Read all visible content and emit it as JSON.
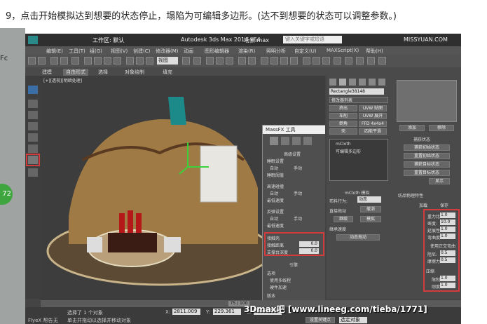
{
  "caption": "9，点击开始模拟达到想要的状态停止，塌陷为可编辑多边形。(达不到想要的状态可以调整参数。)",
  "left_text": "Fc",
  "left_badge": "72",
  "app": {
    "workspace": "工作区: 默认",
    "title": "Autodesk 3ds Max  2014 x64",
    "file": "场景.max",
    "search_placeholder": "键入关键字或短语",
    "site_logo": "MISSYUAN.COM",
    "menus": [
      "编辑(E)",
      "工具(T)",
      "组(G)",
      "视图(V)",
      "创建(C)",
      "修改器(M)",
      "动画",
      "图形编辑器",
      "渲染(R)",
      "照明分析",
      "自定义(U)",
      "MAXScript(X)",
      "帮助(H)"
    ],
    "ribbon_tabs": [
      "建模",
      "自由形式",
      "选择",
      "对象绘制",
      "填充"
    ],
    "view_dropdown": "视图",
    "viewport_label": "[+][透视][明暗处理]"
  },
  "massfx": {
    "title": "MassFX 工具",
    "sections": {
      "advanced": "高级设置",
      "sleep": "睡眠设置",
      "auto": "自动",
      "manual": "手动",
      "sleep_threshold": "睡眠阈值",
      "high_speed": "高速碰撞",
      "min_speed": "最低速度",
      "bounce": "反弹设置",
      "contact_shell": "接触壳",
      "contact_distance_label": "接触距离",
      "contact_distance": "0.0",
      "support_depth_label": "支撑台深度",
      "support_depth": "0.0",
      "engine": "引擎",
      "options": "选项",
      "use_multithread": "使用多线程",
      "hardware_accel": "硬件加速",
      "version": "版本"
    }
  },
  "modifier": {
    "object_name": "Rectangle38148",
    "modifier_list": "修改器列表",
    "buttons": [
      "挤出",
      "UVW 贴图",
      "车削",
      "UVW 展开",
      "倒角",
      "FFD 4x4x4",
      "壳",
      "四能平滑"
    ],
    "stack": [
      "mCloth",
      "可编辑多边形"
    ],
    "rollout": "mCloth 模拟",
    "cloth_behavior_label": "布料行为:",
    "cloth_behavior": "动态",
    "direct_label": "直接拖动",
    "direct_btn": "撤消",
    "sim_btn": "继续",
    "sim_btn2": "模拟",
    "keep_velocity": "继承速度",
    "dynamic_drag": "动态拖动"
  },
  "right_panel": {
    "add_btn": "添加",
    "move_btn": "移除",
    "capture_header": "捕获状态",
    "capture_initial": "捕获初始状态",
    "reset_initial": "重置初始状态",
    "capture_target": "捕获目标状态",
    "reset_target": "重置目标状态",
    "show_btn": "显示",
    "texture_header": "纺品物理特性",
    "load_btn": "加载",
    "save_btn": "保存",
    "params": [
      {
        "label": "重力比:",
        "value": "1.0"
      },
      {
        "label": "密度:",
        "value": "10.0"
      },
      {
        "label": "延展性:",
        "value": "1.0"
      },
      {
        "label": "弯曲度:",
        "value": "1.0"
      }
    ],
    "use_tension": "使用正交弯曲",
    "damping_label": "阻尼:",
    "damping": "0.5",
    "friction_label": "摩擦力:",
    "friction": "0.5",
    "compress_header": "压缩",
    "limit_label": "限制:",
    "limit": "1.0",
    "stiffness_label": "刚度:",
    "stiffness": "1.0"
  },
  "status": {
    "selected": "选择了 1 个对象",
    "hint": "单击并拖动以选择并移动对象",
    "x_label": "X:",
    "x": "2811.009",
    "y_label": "Y:",
    "y": "229.361",
    "z_label": "Z:",
    "z": "1902.226",
    "frame": "75 / 100",
    "flux_label": "FlyeX 帮告",
    "flux_value": "无",
    "set_key": "设置关键点",
    "selection": "选定对象"
  },
  "watermark": "3Dmax吧  [www.lineeg.com/tieba/1771]"
}
